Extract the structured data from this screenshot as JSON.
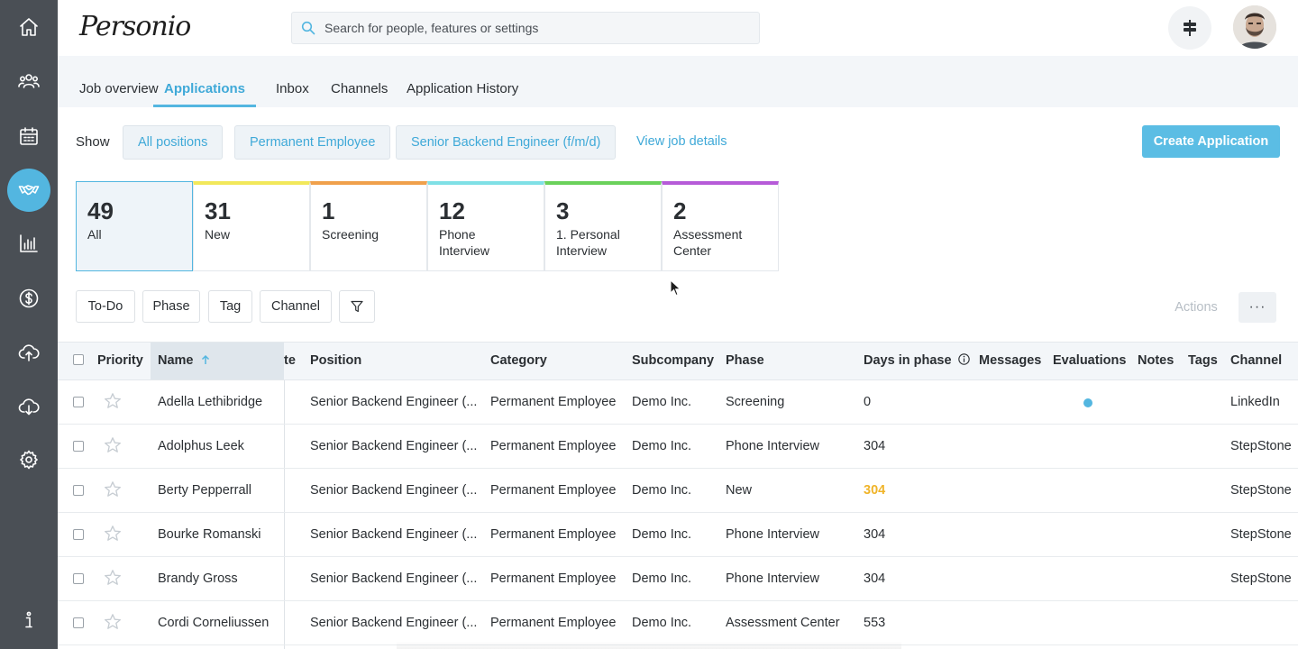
{
  "header": {
    "logo_text": "Personio",
    "search_placeholder": "Search for people, features or settings"
  },
  "sidebar": {
    "items": [
      {
        "icon": "home-icon"
      },
      {
        "icon": "people-icon"
      },
      {
        "icon": "calendar-icon"
      },
      {
        "icon": "handshake-icon",
        "active": true
      },
      {
        "icon": "bar-chart-icon"
      },
      {
        "icon": "dollar-icon"
      },
      {
        "icon": "cloud-upload-icon"
      },
      {
        "icon": "cloud-download-icon"
      },
      {
        "icon": "gear-icon"
      },
      {
        "icon": "info-icon"
      }
    ]
  },
  "tabs": [
    "Job overview",
    "Applications",
    "Inbox",
    "Channels",
    "Application History"
  ],
  "active_tab": "Applications",
  "filters": {
    "show_label": "Show",
    "all_positions": "All positions",
    "employment_type": "Permanent Employee",
    "position": "Senior Backend Engineer (f/m/d)",
    "view_job_details": "View job details",
    "create_application": "Create Application"
  },
  "phases": [
    {
      "count": "49",
      "label": "All",
      "color": "#53b6e0"
    },
    {
      "count": "31",
      "label": "New",
      "color": "#f2e85a"
    },
    {
      "count": "1",
      "label": "Screening",
      "color": "#f0a04b"
    },
    {
      "count": "12",
      "label": "Phone Interview",
      "color": "#7fe0e6"
    },
    {
      "count": "3",
      "label": "1. Personal Interview",
      "color": "#6ad15a"
    },
    {
      "count": "2",
      "label": "Assessment Center",
      "color": "#b65ad8"
    }
  ],
  "filter_buttons": {
    "todo": "To-Do",
    "phase": "Phase",
    "tag": "Tag",
    "channel": "Channel",
    "actions": "Actions",
    "more": "···"
  },
  "table": {
    "headers": {
      "priority": "Priority",
      "name": "Name",
      "date_fragment": "te",
      "position": "Position",
      "category": "Category",
      "subcompany": "Subcompany",
      "phase": "Phase",
      "days_in_phase": "Days in phase",
      "messages": "Messages",
      "evaluations": "Evaluations",
      "notes": "Notes",
      "tags": "Tags",
      "channel": "Channel"
    },
    "rows": [
      {
        "name": "Adella Lethibridge",
        "position": "Senior Backend Engineer (...",
        "category": "Permanent Employee",
        "subcompany": "Demo Inc.",
        "phase": "Screening",
        "days": "0",
        "evaluation": true,
        "channel": "LinkedIn"
      },
      {
        "name": "Adolphus Leek",
        "position": "Senior Backend Engineer (...",
        "category": "Permanent Employee",
        "subcompany": "Demo Inc.",
        "phase": "Phone Interview",
        "days": "304",
        "channel": "StepStone"
      },
      {
        "name": "Berty Pepperrall",
        "position": "Senior Backend Engineer (...",
        "category": "Permanent Employee",
        "subcompany": "Demo Inc.",
        "phase": "New",
        "days": "304",
        "days_highlight": true,
        "channel": "StepStone"
      },
      {
        "name": "Bourke Romanski",
        "position": "Senior Backend Engineer (...",
        "category": "Permanent Employee",
        "subcompany": "Demo Inc.",
        "phase": "Phone Interview",
        "days": "304",
        "channel": "StepStone"
      },
      {
        "name": "Brandy Gross",
        "position": "Senior Backend Engineer (...",
        "category": "Permanent Employee",
        "subcompany": "Demo Inc.",
        "phase": "Phone Interview",
        "days": "304",
        "channel": "StepStone"
      },
      {
        "name": "Cordi Corneliussen",
        "position": "Senior Backend Engineer (...",
        "category": "Permanent Employee",
        "subcompany": "Demo Inc.",
        "phase": "Assessment Center",
        "days": "553",
        "channel": ""
      }
    ]
  }
}
